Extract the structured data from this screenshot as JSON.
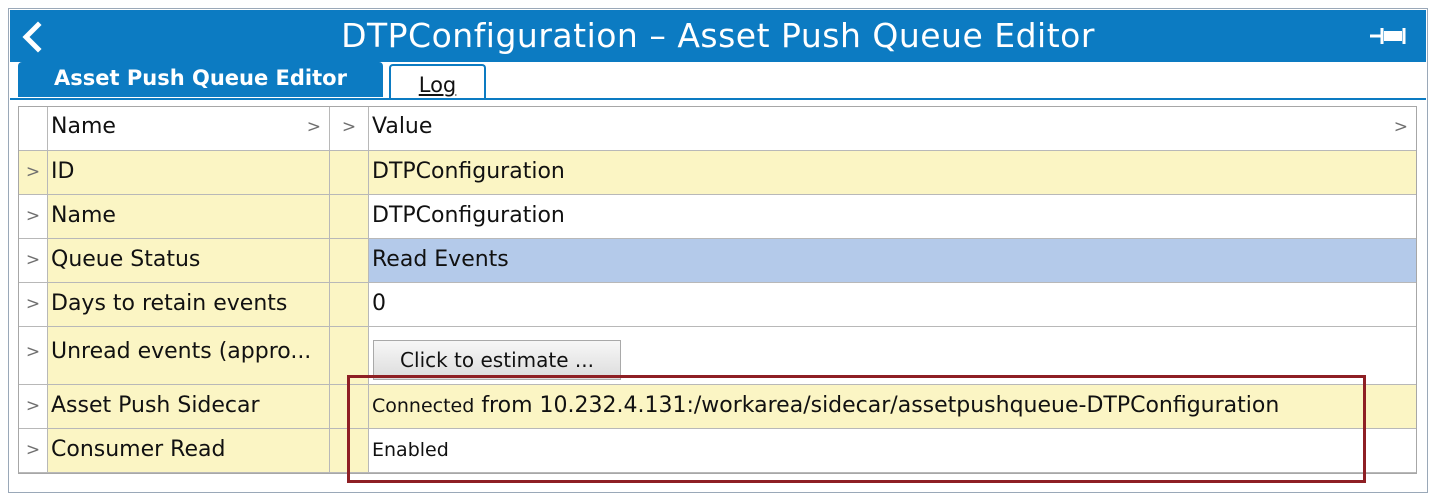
{
  "window": {
    "title": "DTPConfiguration – Asset Push Queue Editor",
    "accent_color": "#0c7bc2",
    "back_icon": "chevron-left-icon",
    "pin_icon": "pin-icon"
  },
  "tabs": [
    {
      "label": "Asset Push Queue Editor",
      "active": true
    },
    {
      "label": "Log",
      "active": false
    }
  ],
  "table": {
    "header": {
      "name": "Name",
      "value": "Value"
    },
    "rows": [
      {
        "name": "ID",
        "value": "DTPConfiguration"
      },
      {
        "name": "Name",
        "value": "DTPConfiguration"
      },
      {
        "name": "Queue Status",
        "value": "Read Events"
      },
      {
        "name": "Days to retain events",
        "value": "0"
      },
      {
        "name": "Unread events (appro...",
        "button": "Click to estimate ..."
      },
      {
        "name": "Asset Push Sidecar",
        "value_prefix": "Connected",
        "value": "from 10.232.4.131:/workarea/sidecar/assetpushqueue-DTPConfiguration"
      },
      {
        "name": "Consumer Read",
        "value": "Enabled"
      }
    ]
  },
  "colors": {
    "row_yellow": "#fbf5c4",
    "selected_row": "#b4caea",
    "highlight_border": "#8e1f24"
  }
}
